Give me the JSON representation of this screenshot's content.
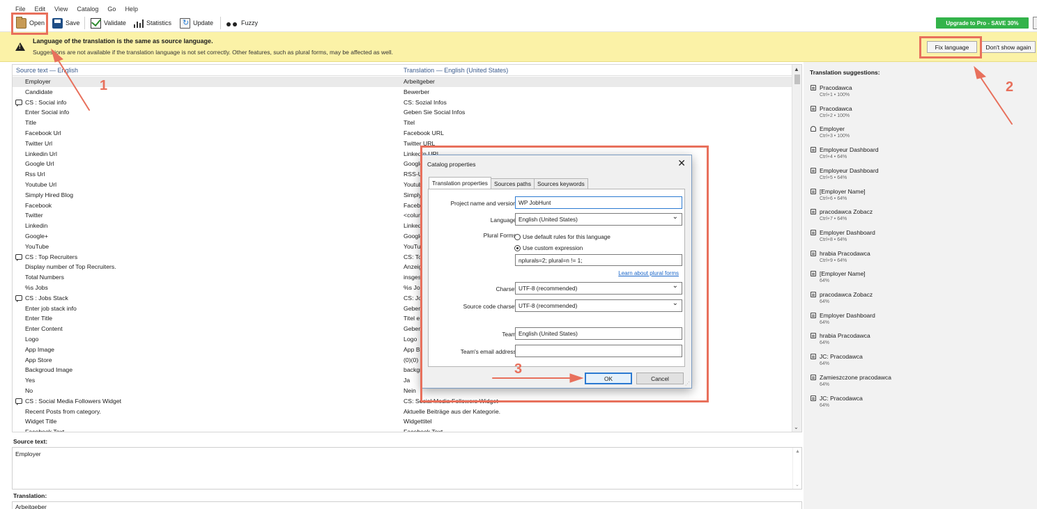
{
  "menu": [
    "File",
    "Edit",
    "View",
    "Catalog",
    "Go",
    "Help"
  ],
  "toolbar": {
    "open": "Open",
    "save": "Save",
    "validate": "Validate",
    "statistics": "Statistics",
    "update": "Update",
    "fuzzy": "Fuzzy",
    "upgrade": "Upgrade to Pro - SAVE 30%"
  },
  "warning": {
    "title": "Language of the translation is the same as source language.",
    "text": "Suggestions are not available if the translation language is not set correctly. Other features, such as plural forms, may be affected as well.",
    "fix_button": "Fix language",
    "dismiss_button": "Don't show again"
  },
  "list": {
    "source_header": "Source text — English",
    "translation_header": "Translation — English (United States)",
    "rows": [
      {
        "src": "Employer",
        "trn": "Arbeitgeber",
        "group": false,
        "selected": true
      },
      {
        "src": "Candidate",
        "trn": "Bewerber",
        "group": false
      },
      {
        "src": "CS : Social info",
        "trn": "CS: Sozial Infos",
        "group": true
      },
      {
        "src": "Enter Social info",
        "trn": "Geben Sie Social Infos",
        "group": false
      },
      {
        "src": "Title",
        "trn": "Titel",
        "group": false
      },
      {
        "src": "Facebook Url",
        "trn": "Facebook URL",
        "group": false
      },
      {
        "src": "Twitter Url",
        "trn": "Twitter URL",
        "group": false
      },
      {
        "src": "Linkedin Url",
        "trn": "LinkedIn URL",
        "group": false
      },
      {
        "src": "Google Url",
        "trn": "Google URL",
        "group": false
      },
      {
        "src": "Rss Url",
        "trn": "RSS-URL",
        "group": false
      },
      {
        "src": "Youtube Url",
        "trn": "Youtube URL",
        "group": false
      },
      {
        "src": "Simply Hired Blog",
        "trn": "Simply Hired Blog",
        "group": false
      },
      {
        "src": "Facebook",
        "trn": "Facebook",
        "group": false
      },
      {
        "src": "Twitter",
        "trn": "<column",
        "group": false
      },
      {
        "src": "Linkedin",
        "trn": "Linkedin",
        "group": false
      },
      {
        "src": "Google+",
        "trn": "Google+",
        "group": false
      },
      {
        "src": "YouTube",
        "trn": "YouTube",
        "group": false
      },
      {
        "src": "CS : Top Recruiters",
        "trn": "CS: Top Recruiters",
        "group": true
      },
      {
        "src": "Display number of Top Recruiters.",
        "trn": "Anzeige",
        "group": false
      },
      {
        "src": "Total Numbers",
        "trn": "insgesamt",
        "group": false
      },
      {
        "src": "%s Jobs",
        "trn": "%s Jobs",
        "group": false
      },
      {
        "src": "CS : Jobs Stack",
        "trn": "CS: Jobs Stack",
        "group": true
      },
      {
        "src": "Enter job stack info",
        "trn": "Geben Sie",
        "group": false
      },
      {
        "src": "Enter Title",
        "trn": "Titel eingeben",
        "group": false
      },
      {
        "src": "Enter Content",
        "trn": "Geben Sie",
        "group": false
      },
      {
        "src": "Logo",
        "trn": "Logo",
        "group": false
      },
      {
        "src": "App Image",
        "trn": "App Bild",
        "group": false
      },
      {
        "src": "App Store",
        "trn": "(0)(0)",
        "group": false
      },
      {
        "src": "Backgroud Image",
        "trn": "background",
        "group": false
      },
      {
        "src": "Yes",
        "trn": "Ja",
        "group": false
      },
      {
        "src": "No",
        "trn": "Nein",
        "group": false
      },
      {
        "src": "CS : Social Media Followers Widget",
        "trn": "CS: Social Media Followers Widget",
        "group": true
      },
      {
        "src": "Recent Posts from category.",
        "trn": "Aktuelle Beiträge aus der Kategorie.",
        "group": false
      },
      {
        "src": "Widget Title",
        "trn": "Widgettitel",
        "group": false
      },
      {
        "src": "Facebook Text",
        "trn": "Facebook Text",
        "group": false
      }
    ]
  },
  "editors": {
    "source_label": "Source text:",
    "source_value": "Employer",
    "translation_label": "Translation:",
    "translation_value": "Arbeitgeber"
  },
  "suggestions": {
    "title": "Translation suggestions:",
    "items": [
      {
        "text": "Pracodawca",
        "meta": "Ctrl+1 • 100%",
        "icon": "db"
      },
      {
        "text": "Pracodawca",
        "meta": "Ctrl+2 • 100%",
        "icon": "db"
      },
      {
        "text": "Employer",
        "meta": "Ctrl+3 • 100%",
        "icon": "user"
      },
      {
        "text": "Employeur Dashboard",
        "meta": "Ctrl+4 • 64%",
        "icon": "db"
      },
      {
        "text": "Employeur Dashboard",
        "meta": "Ctrl+5 • 64%",
        "icon": "db"
      },
      {
        "text": "[Employer Name]",
        "meta": "Ctrl+6 • 64%",
        "icon": "db"
      },
      {
        "text": "pracodawca Zobacz",
        "meta": "Ctrl+7 • 64%",
        "icon": "db"
      },
      {
        "text": "Employer Dashboard",
        "meta": "Ctrl+8 • 64%",
        "icon": "db"
      },
      {
        "text": "hrabia Pracodawca",
        "meta": "Ctrl+9 • 64%",
        "icon": "db"
      },
      {
        "text": "[Employer Name]",
        "meta": "64%",
        "icon": "db"
      },
      {
        "text": "pracodawca Zobacz",
        "meta": "64%",
        "icon": "db"
      },
      {
        "text": "Employer Dashboard",
        "meta": "64%",
        "icon": "db"
      },
      {
        "text": "hrabia Pracodawca",
        "meta": "64%",
        "icon": "db"
      },
      {
        "text": "JC: Pracodawca",
        "meta": "64%",
        "icon": "db"
      },
      {
        "text": "Zamieszczone pracodawca",
        "meta": "64%",
        "icon": "db"
      },
      {
        "text": "JC: Pracodawca",
        "meta": "64%",
        "icon": "db"
      }
    ]
  },
  "dialog": {
    "title": "Catalog properties",
    "close": "✕",
    "tabs": [
      "Translation properties",
      "Sources paths",
      "Sources keywords"
    ],
    "fields": {
      "project_label": "Project name and version:",
      "project_value": "WP JobHunt",
      "language_label": "Language:",
      "language_value": "English (United States)",
      "plural_label": "Plural Forms:",
      "plural_default": "Use default rules for this language",
      "plural_custom": "Use custom expression",
      "plural_expr": "nplurals=2; plural=n != 1;",
      "plural_link": "Learn about plural forms",
      "charset_label": "Charset:",
      "charset_value": "UTF-8 (recommended)",
      "src_charset_label": "Source code charset:",
      "src_charset_value": "UTF-8 (recommended)",
      "team_label": "Team:",
      "team_value": "English (United States)",
      "email_label": "Team's email address:",
      "email_value": ""
    },
    "ok": "OK",
    "cancel": "Cancel"
  },
  "annotations": {
    "step1": "1",
    "step2": "2",
    "step3": "3",
    "color": "#e8705c"
  }
}
